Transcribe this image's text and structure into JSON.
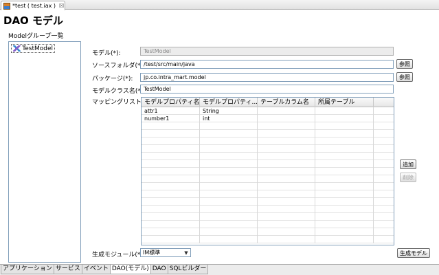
{
  "editor_tab": {
    "title": "*test ( test.iax )",
    "close": "☒"
  },
  "page_title": "DAO モデル",
  "group_panel": {
    "label": "Modelグループ一覧",
    "items": [
      {
        "label": "TestModel"
      }
    ]
  },
  "form": {
    "model": {
      "label": "モデル(*):",
      "value": "TestModel"
    },
    "source_folder": {
      "label": "ソースフォルダ(*):",
      "value": "/test/src/main/java",
      "browse_label": "参照"
    },
    "package": {
      "label": "パッケージ(*):",
      "value": "jp.co.intra_mart.model",
      "browse_label": "参照"
    },
    "model_class": {
      "label": "モデルクラス名(*):",
      "value": "TestModel"
    },
    "mapping": {
      "label": "マッピングリスト(*):",
      "columns": [
        "モデルプロパティ名",
        "モデルプロパティ...",
        "テーブルカラム名",
        "所属テーブル",
        ""
      ],
      "rows": [
        [
          "attr1",
          "String",
          "",
          "",
          ""
        ],
        [
          "number1",
          "int",
          "",
          "",
          ""
        ],
        [
          "",
          "",
          "",
          "",
          ""
        ],
        [
          "",
          "",
          "",
          "",
          ""
        ],
        [
          "",
          "",
          "",
          "",
          ""
        ],
        [
          "",
          "",
          "",
          "",
          ""
        ],
        [
          "",
          "",
          "",
          "",
          ""
        ],
        [
          "",
          "",
          "",
          "",
          ""
        ],
        [
          "",
          "",
          "",
          "",
          ""
        ],
        [
          "",
          "",
          "",
          "",
          ""
        ],
        [
          "",
          "",
          "",
          "",
          ""
        ],
        [
          "",
          "",
          "",
          "",
          ""
        ],
        [
          "",
          "",
          "",
          "",
          ""
        ],
        [
          "",
          "",
          "",
          "",
          ""
        ],
        [
          "",
          "",
          "",
          "",
          ""
        ],
        [
          "",
          "",
          "",
          "",
          ""
        ],
        [
          "",
          "",
          "",
          "",
          ""
        ],
        [
          "",
          "",
          "",
          "",
          ""
        ]
      ],
      "add_label": "追加",
      "delete_label": "削除"
    },
    "module": {
      "label": "生成モジュール(*):",
      "value": "IM標準",
      "arrow": "▼"
    },
    "generate_label": "生成モデル"
  },
  "bottom_tabs": [
    {
      "label": "アプリケーション",
      "active": false
    },
    {
      "label": "サービス",
      "active": false
    },
    {
      "label": "イベント",
      "active": false
    },
    {
      "label": "DAO(モデル)",
      "active": true
    },
    {
      "label": "DAO",
      "active": false
    },
    {
      "label": "SQLビルダー",
      "active": false
    }
  ]
}
